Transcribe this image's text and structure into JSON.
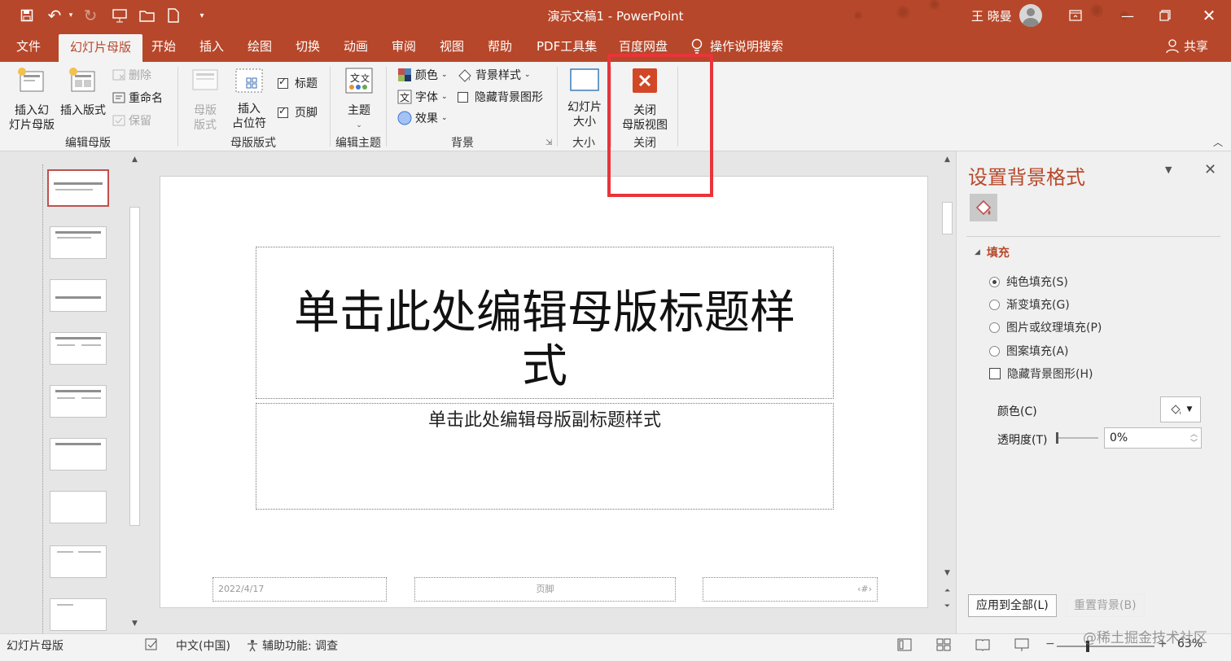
{
  "window": {
    "title": "演示文稿1 - PowerPoint",
    "user_name": "王 晓曼"
  },
  "tabs": [
    {
      "label": "文件"
    },
    {
      "label": "幻灯片母版"
    },
    {
      "label": "开始"
    },
    {
      "label": "插入"
    },
    {
      "label": "绘图"
    },
    {
      "label": "切换"
    },
    {
      "label": "动画"
    },
    {
      "label": "审阅"
    },
    {
      "label": "视图"
    },
    {
      "label": "帮助"
    },
    {
      "label": "PDF工具集"
    },
    {
      "label": "百度网盘"
    }
  ],
  "search_label": "操作说明搜索",
  "share_label": "共享",
  "ribbon": {
    "edit_master": {
      "insert_master": "插入幻\n灯片母版",
      "insert_layout": "插入版式",
      "delete": "删除",
      "rename": "重命名",
      "preserve": "保留",
      "group": "编辑母版"
    },
    "master_layout": {
      "master_layout_btn": "母版\n版式",
      "insert_placeholder": "插入\n占位符",
      "title_cb": "标题",
      "footer_cb": "页脚",
      "group": "母版版式"
    },
    "edit_theme": {
      "themes": "主题",
      "group": "编辑主题"
    },
    "background": {
      "colors": "颜色",
      "fonts": "字体",
      "effects": "效果",
      "bg_styles": "背景样式",
      "hide_bg": "隐藏背景图形",
      "group": "背景"
    },
    "size": {
      "slide_size": "幻灯片\n大小",
      "group": "大小"
    },
    "close": {
      "close_master": "关闭\n母版视图",
      "group": "关闭"
    }
  },
  "slide": {
    "title_placeholder": "单击此处编辑母版标题样\n式",
    "subtitle_placeholder": "单击此处编辑母版副标题样式",
    "date": "2022/4/17",
    "footer": "页脚",
    "slide_number": "‹#›"
  },
  "format_pane": {
    "title": "设置背景格式",
    "section": "填充",
    "options": [
      {
        "label": "纯色填充(S)",
        "selected": true
      },
      {
        "label": "渐变填充(G)",
        "selected": false
      },
      {
        "label": "图片或纹理填充(P)",
        "selected": false
      },
      {
        "label": "图案填充(A)",
        "selected": false
      }
    ],
    "hide_bg_label": "隐藏背景图形(H)",
    "color_label": "颜色(C)",
    "transparency_label": "透明度(T)",
    "transparency_value": "0%",
    "transparency_fraction": 0,
    "apply_all": "应用到全部(L)",
    "reset_bg": "重置背景(B)"
  },
  "statusbar": {
    "view": "幻灯片母版",
    "language": "中文(中国)",
    "accessibility": "辅助功能: 调查",
    "zoom": "63%",
    "watermark": "@稀土掘金技术社区"
  },
  "colors": {
    "brand": "#b7472a",
    "highlight": "#e8343a"
  }
}
